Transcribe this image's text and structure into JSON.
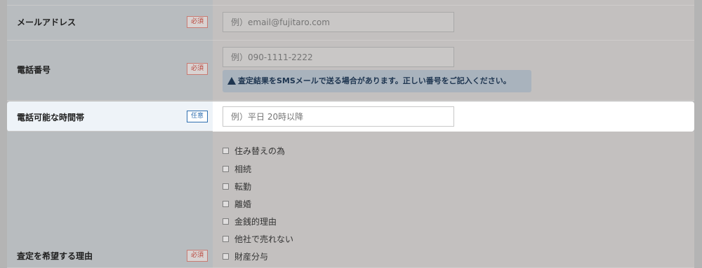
{
  "fields": {
    "email": {
      "label": "メールアドレス",
      "badge": "必須",
      "placeholder": "例）email@fujitaro.com"
    },
    "phone": {
      "label": "電話番号",
      "badge": "必須",
      "placeholder": "例）090-1111-2222",
      "notice": "査定結果をSMSメールで送る場合があります。正しい番号をご記入ください。"
    },
    "call_time": {
      "label": "電話可能な時間帯",
      "badge": "任意",
      "placeholder": "例）平日 20時以降"
    },
    "reason": {
      "label": "査定を希望する理由",
      "badge": "必須",
      "options": [
        "住み替えの為",
        "相続",
        "転勤",
        "離婚",
        "金銭的理由",
        "他社で売れない",
        "財産分与"
      ]
    }
  },
  "colors": {
    "required_badge": "#b8453a",
    "optional_badge": "#2f6fb0",
    "notice_text": "#1e3550"
  },
  "icons": {
    "notice_icon": "warning-triangle-icon"
  }
}
